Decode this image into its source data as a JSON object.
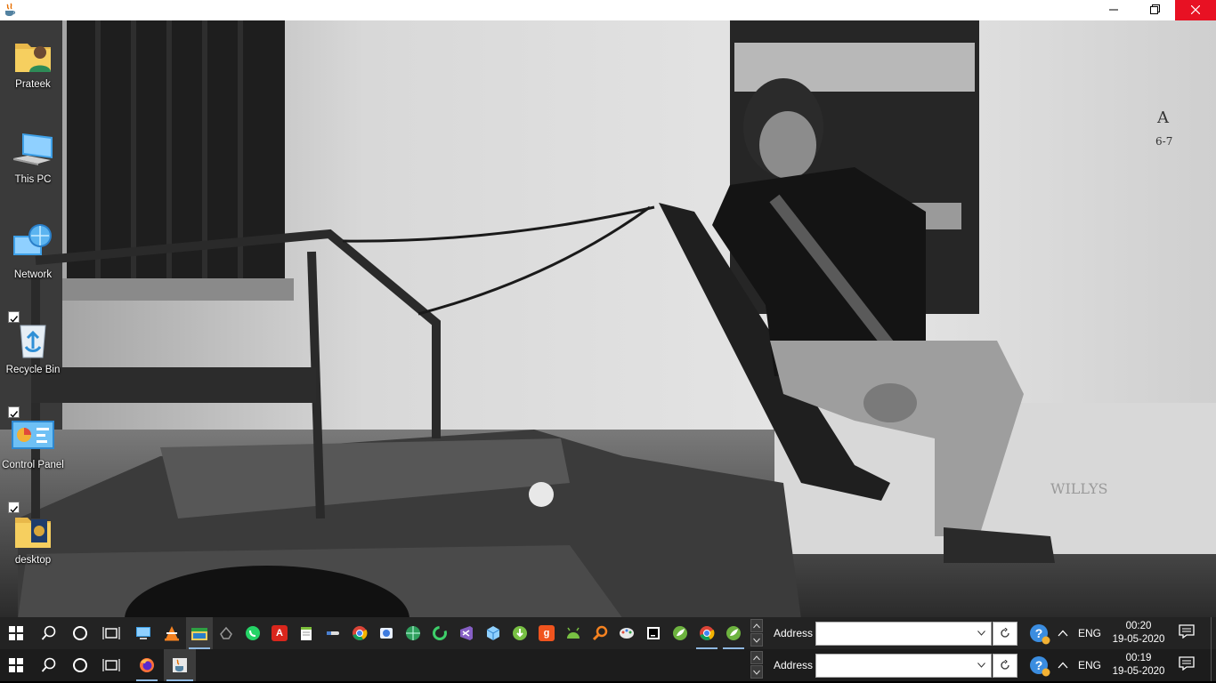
{
  "window": {
    "icon": "java-icon",
    "controls": [
      "minimize-icon",
      "maximize-icon",
      "close-icon"
    ],
    "close_color": "#e81123"
  },
  "desktop": {
    "icons": [
      {
        "label": "Prateek",
        "icon": "user-folder-icon",
        "checkbox": false
      },
      {
        "label": "This PC",
        "icon": "computer-icon",
        "checkbox": false
      },
      {
        "label": "Network",
        "icon": "network-icon",
        "checkbox": false
      },
      {
        "label": "Recycle Bin",
        "icon": "recycle-bin-icon",
        "checkbox": true
      },
      {
        "label": "Control Panel",
        "icon": "control-panel-icon",
        "checkbox": true
      },
      {
        "label": "desktop",
        "icon": "folder-icon",
        "checkbox": true
      }
    ]
  },
  "taskbar_top": {
    "pinned": [
      "computer-icon",
      "vlc-icon",
      "file-explorer-icon",
      "app-icon",
      "whatsapp-icon",
      "acrobat-icon",
      "notepad-icon",
      "pen-icon",
      "chrome-icon",
      "app-icon",
      "globe-icon",
      "refresh-icon",
      "visual-studio-icon",
      "cube-icon",
      "torrent-icon",
      "g-icon",
      "android-studio-icon",
      "search-app-icon",
      "paint-icon",
      "terminal-icon",
      "spring-icon",
      "chrome-icon",
      "spring-icon"
    ],
    "address_label": "Address",
    "address_value": "",
    "language": "ENG",
    "time": "00:20",
    "date": "19-05-2020"
  },
  "taskbar_bottom": {
    "pinned": [
      "firefox-icon",
      "java-icon"
    ],
    "address_label": "Address",
    "address_value": "",
    "language": "ENG",
    "time": "00:19",
    "date": "19-05-2020"
  }
}
